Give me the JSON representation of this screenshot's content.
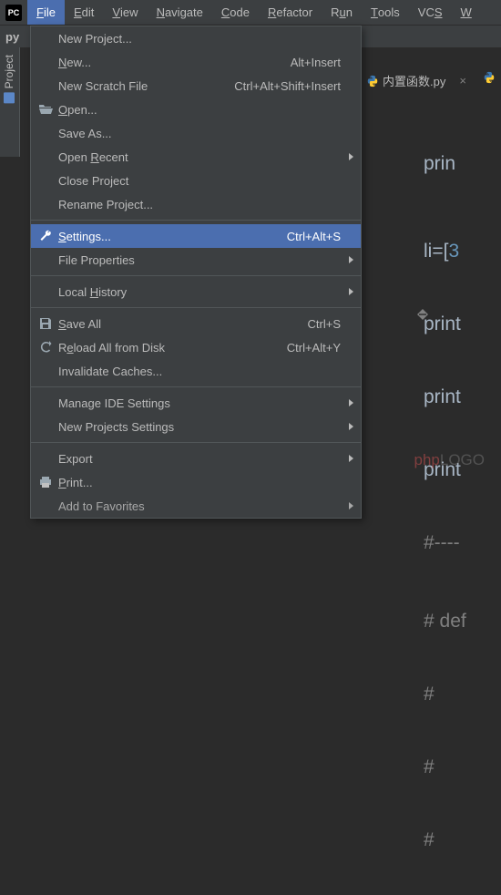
{
  "menubar": {
    "items": [
      {
        "pre": "",
        "u": "F",
        "post": "ile"
      },
      {
        "pre": "",
        "u": "E",
        "post": "dit"
      },
      {
        "pre": "",
        "u": "V",
        "post": "iew"
      },
      {
        "pre": "",
        "u": "N",
        "post": "avigate"
      },
      {
        "pre": "",
        "u": "C",
        "post": "ode"
      },
      {
        "pre": "",
        "u": "R",
        "post": "efactor"
      },
      {
        "pre": "R",
        "u": "u",
        "post": "n"
      },
      {
        "pre": "",
        "u": "T",
        "post": "ools"
      },
      {
        "pre": "VC",
        "u": "S",
        "post": ""
      },
      {
        "pre": "",
        "u": "W",
        "post": ""
      }
    ],
    "logo": "PC"
  },
  "breadcrumb": "py",
  "toolwin": {
    "project": "Project"
  },
  "tabs": {
    "file": "内置函数.py"
  },
  "editor": {
    "line_top": "prin",
    "l1_a": "li=[",
    "l1_b": "3",
    "l2": "print",
    "l3": "print",
    "l4": "print",
    "l5": "#----",
    "l6": "# def",
    "l7": "#",
    "l8": "#",
    "l9": "#"
  },
  "menu": {
    "new_project": "New Project...",
    "new": {
      "pre": "",
      "u": "N",
      "post": "ew...",
      "shortcut": "Alt+Insert"
    },
    "new_scratch": {
      "label": "New Scratch File",
      "shortcut": "Ctrl+Alt+Shift+Insert"
    },
    "open": {
      "pre": "",
      "u": "O",
      "post": "pen..."
    },
    "save_as": "Save As...",
    "open_recent": {
      "pre": "Open ",
      "u": "R",
      "post": "ecent"
    },
    "close_project": "Close Project",
    "rename_project": "Rename Project...",
    "settings": {
      "pre": "",
      "u": "S",
      "post": "ettings...",
      "shortcut": "Ctrl+Alt+S"
    },
    "file_properties": "File Properties",
    "local_history": {
      "pre": "Local ",
      "u": "H",
      "post": "istory"
    },
    "save_all": {
      "pre": "",
      "u": "S",
      "post": "ave All",
      "shortcut": "Ctrl+S"
    },
    "reload": {
      "pre": "R",
      "u": "e",
      "post": "load All from Disk",
      "shortcut": "Ctrl+Alt+Y"
    },
    "invalidate": "Invalidate Caches...",
    "manage_ide": "Manage IDE Settings",
    "new_proj_settings": "New Projects Settings",
    "export": "Export",
    "print": {
      "pre": "",
      "u": "P",
      "post": "rint..."
    },
    "add_fav": "Add to Favorites"
  },
  "watermark": {
    "p": "php",
    "rest": "LOGO"
  }
}
